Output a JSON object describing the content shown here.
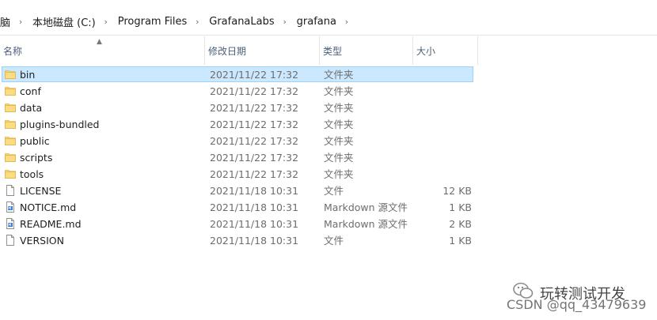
{
  "breadcrumb": [
    "脑",
    "本地磁盘 (C:)",
    "Program Files",
    "GrafanaLabs",
    "grafana"
  ],
  "columns": {
    "name": "名称",
    "date": "修改日期",
    "type": "类型",
    "size": "大小"
  },
  "files": [
    {
      "name": "bin",
      "date": "2021/11/22 17:32",
      "type": "文件夹",
      "size": "",
      "icon": "folder-icon",
      "selected": true
    },
    {
      "name": "conf",
      "date": "2021/11/22 17:32",
      "type": "文件夹",
      "size": "",
      "icon": "folder-icon"
    },
    {
      "name": "data",
      "date": "2021/11/22 17:32",
      "type": "文件夹",
      "size": "",
      "icon": "folder-icon"
    },
    {
      "name": "plugins-bundled",
      "date": "2021/11/22 17:32",
      "type": "文件夹",
      "size": "",
      "icon": "folder-icon"
    },
    {
      "name": "public",
      "date": "2021/11/22 17:32",
      "type": "文件夹",
      "size": "",
      "icon": "folder-icon"
    },
    {
      "name": "scripts",
      "date": "2021/11/22 17:32",
      "type": "文件夹",
      "size": "",
      "icon": "folder-icon"
    },
    {
      "name": "tools",
      "date": "2021/11/22 17:32",
      "type": "文件夹",
      "size": "",
      "icon": "folder-icon"
    },
    {
      "name": "LICENSE",
      "date": "2021/11/18 10:31",
      "type": "文件",
      "size": "12 KB",
      "icon": "file-icon"
    },
    {
      "name": "NOTICE.md",
      "date": "2021/11/18 10:31",
      "type": "Markdown 源文件",
      "size": "1 KB",
      "icon": "markdown-file-icon"
    },
    {
      "name": "README.md",
      "date": "2021/11/18 10:31",
      "type": "Markdown 源文件",
      "size": "2 KB",
      "icon": "markdown-file-icon"
    },
    {
      "name": "VERSION",
      "date": "2021/11/18 10:31",
      "type": "文件",
      "size": "1 KB",
      "icon": "file-icon"
    }
  ],
  "watermark": {
    "wechat": "玩转测试开发",
    "csdn": "CSDN @qq_43479639"
  },
  "colors": {
    "selected_bg": "#cce8ff",
    "selected_border": "#99d1ff",
    "folder": "#f8d775",
    "header_text": "#4c607a"
  }
}
